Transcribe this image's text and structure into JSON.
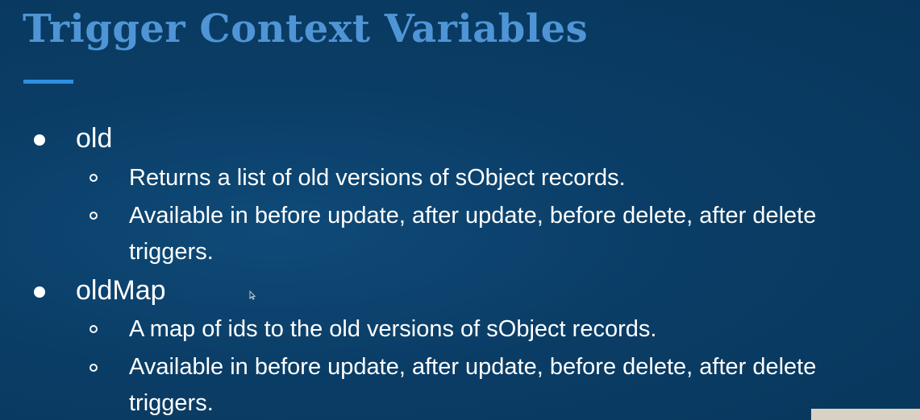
{
  "slide": {
    "title": "Trigger Context Variables",
    "sections": [
      {
        "term": "old",
        "points": [
          {
            "line1": "Returns a list of old versions of sObject records.",
            "line2": ""
          },
          {
            "line1": "Available in before update, after update, before delete, after delete",
            "line2": "triggers."
          }
        ]
      },
      {
        "term": "oldMap",
        "points": [
          {
            "line1": "A map of ids to the old versions of sObject records.",
            "line2": ""
          },
          {
            "line1": "Available in before update, after update, before delete, after delete",
            "line2": "triggers."
          }
        ]
      }
    ]
  },
  "colors": {
    "background": "#0a3d66",
    "title": "#4f95d6",
    "accent_underline": "#2e8fe0",
    "text": "#ffffff"
  },
  "icons": {
    "level1_bullet": "filled-circle",
    "level2_bullet": "hollow-circle",
    "pointer": "mouse-cursor-icon"
  }
}
